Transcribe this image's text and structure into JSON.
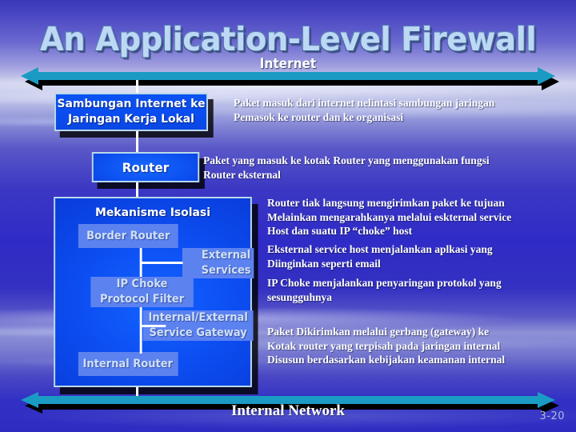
{
  "slide": {
    "title": "An Application-Level Firewall",
    "page_number": "3-20",
    "accent_color": "#1a9bc4",
    "box_fill_color": "#0b4de8",
    "box_border_color": "#b9d9ea",
    "inner_box_color": "#5c82f0",
    "title_color": "#bcd8f4"
  },
  "top_arrow": {
    "label": "Internet",
    "icon": "double-headed-arrow-icon"
  },
  "bottom_arrow": {
    "label": "Internal Network",
    "icon": "double-headed-arrow-icon"
  },
  "boxes": {
    "sambungan": "Sambungan Internet ke\nJaringan Kerja Lokal",
    "router": "Router",
    "mekanisme_title": "Mekanisme Isolasi",
    "border_router": "Border Router",
    "external_services": "External\nServices",
    "ip_choke": "IP Choke\nProtocol Filter",
    "gateway": "Internal/External\nService Gateway",
    "internal_router": "Internal Router"
  },
  "notes": {
    "note1": "Paket masuk dari internet nelintasi sambungan jaringan\nPemasok ke router dan ke organisasi",
    "note2": "Paket yang masuk ke kotak Router yang menggunakan fungsi\nRouter eksternal",
    "note3": "Router tiak langsung mengirimkan paket ke tujuan\nMelainkan mengarahkanya melalui eskternal service\nHost dan suatu IP “choke” host",
    "note4": "Eksternal service host menjalankan aplkasi yang\nDiinginkan seperti email",
    "note5": "IP Choke menjalankan penyaringan protokol yang\nsesungguhnya",
    "note6": "Paket Dikirimkan melalui gerbang (gateway) ke\nKotak router yang terpisah pada jaringan internal\nDisusun berdasarkan kebijakan keamanan internal"
  }
}
